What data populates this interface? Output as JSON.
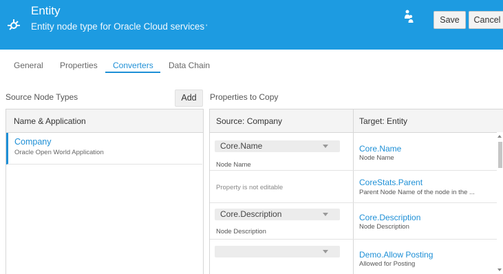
{
  "header": {
    "title": "Entity",
    "subtitle": "Entity node type for Oracle Cloud services",
    "subtitle_mark": "'",
    "icon": "node-type-icon",
    "people_icon": "people-icon",
    "save_label": "Save",
    "cancel_label": "Cancel",
    "accent_color": "#1d9be1"
  },
  "tabs": [
    {
      "label": "General",
      "active": false
    },
    {
      "label": "Properties",
      "active": false
    },
    {
      "label": "Converters",
      "active": true
    },
    {
      "label": "Data Chain",
      "active": false
    }
  ],
  "source_node_types": {
    "label": "Source Node Types",
    "add_label": "Add",
    "column_header": "Name & Application",
    "items": [
      {
        "name": "Company",
        "application": "Oracle Open World Application",
        "selected": true
      }
    ]
  },
  "properties_to_copy": {
    "label": "Properties to Copy",
    "source_header": "Source: Company",
    "target_header": "Target: Entity",
    "rows": [
      {
        "source_value": "Core.Name",
        "source_desc": "Node Name",
        "target_name": "Core.Name",
        "target_desc": "Node Name"
      },
      {
        "source_value": "",
        "source_desc": "Property is not editable",
        "target_name": "CoreStats.Parent",
        "target_desc": "Parent Node Name of the node in the ..."
      },
      {
        "source_value": "Core.Description",
        "source_desc": "Node Description",
        "target_name": "Core.Description",
        "target_desc": "Node Description"
      },
      {
        "source_value": "",
        "source_desc": "",
        "target_name": "Demo.Allow Posting",
        "target_desc": "Allowed for Posting"
      }
    ]
  }
}
